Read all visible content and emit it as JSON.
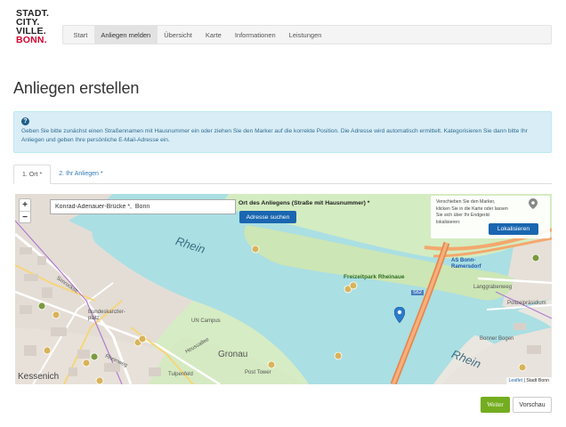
{
  "logo": {
    "line1": "STADT.",
    "line2": "CITY.",
    "line3": "VILLE.",
    "line4": "BONN."
  },
  "nav": {
    "items": [
      {
        "label": "Start"
      },
      {
        "label": "Anliegen melden"
      },
      {
        "label": "Übersicht"
      },
      {
        "label": "Karte"
      },
      {
        "label": "Informationen"
      },
      {
        "label": "Leistungen"
      }
    ],
    "active": "Anliegen melden"
  },
  "page": {
    "title": "Anliegen erstellen"
  },
  "info": {
    "icon": "question-icon",
    "text": "Geben Sie bitte zunächst einen Straßennamen mit Hausnummer ein oder ziehen Sie den Marker auf die korrekte Position. Die Adresse wird automatisch ermittelt. Kategorisieren Sie dann bitte Ihr Anliegen und geben Ihre persönliche E-Mail-Adresse ein."
  },
  "tabs": [
    {
      "label": "1. Ort *",
      "active": true
    },
    {
      "label": "2. Ihr Anliegen *",
      "active": false
    }
  ],
  "map": {
    "zoom_in": "+",
    "zoom_out": "−",
    "address_value": "Konrad-Adenauer-Brücke *,  Bonn",
    "address_label": "Ort des Anliegens (Straße mit Hausnummer) *",
    "search_button": "Adresse suchen",
    "hint": "Verschieben Sie den Marker, klicken Sie in die Karte oder lassen Sie sich über Ihr Endgerät lokalisieren:",
    "locate_button": "Lokalisieren",
    "labels": {
      "rhein1": "Rhein",
      "rhein2": "Rhein",
      "park": "Freizeitpark Rheinaue",
      "gronau": "Gronau",
      "kessenich": "Kessenich",
      "ramersdorf": "AS Bonn-Ramersdorf",
      "bundeskanzlerplatz": "Bundeskanzler-platz",
      "un_campus": "UN Campus",
      "tulpenfeld": "Tulpenfeld",
      "simrockstr": "Simrockstr.",
      "langgrabenweg": "Langgrabenweg",
      "bonner_bogen": "Bonner Bogen",
      "polizeipraesidium": "Polizeipräsidium",
      "s62": "S62",
      "heussallee": "Heussallee",
      "rheinweg": "Rheinweg",
      "post_tower": "Post Tower"
    },
    "attribution_link": "Leaflet",
    "attribution_text": " | Stadt Bonn"
  },
  "footer": {
    "next_button": "Weiter",
    "preview_button": "Vorschau"
  },
  "colors": {
    "accent": "#1a66b0",
    "brand_red": "#d4002d",
    "success": "#74ad1f",
    "info_bg": "#d9edf7",
    "water": "#aadfe3"
  }
}
